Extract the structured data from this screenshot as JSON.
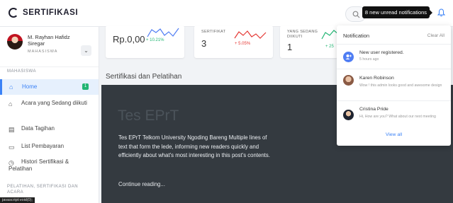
{
  "app": {
    "brand": "SERTIFIKASI"
  },
  "header": {
    "tooltip": "8 new unread notifications"
  },
  "profile": {
    "name": "M. Rayhan Hafidz Siregar",
    "role": "MAHASISWA"
  },
  "sidebar": {
    "heading1": "MAHASISWA",
    "items": [
      {
        "label": "Home",
        "icon": "home-icon",
        "badge": "1"
      },
      {
        "label": "Acara yang Sedang diikuti",
        "icon": "event-icon"
      },
      {
        "label": "Data Tagihan",
        "icon": "document-icon"
      },
      {
        "label": "List Pembayaran",
        "icon": "card-icon"
      },
      {
        "label": "Histori Sertifikasi & Pelatihan",
        "icon": "history-icon"
      }
    ],
    "heading2": "PELATIHAN, SERTIFIKASI DAN ACARA"
  },
  "status_url": "javascript:void(0);",
  "stats": [
    {
      "label": "",
      "value": "Rp.0,00",
      "delta": "+ 10.21%",
      "delta_color": "#22b573",
      "spark_color": "#4f7df3"
    },
    {
      "label": "SERTIFIKAT",
      "value": "3",
      "delta": "+ 5.05%",
      "delta_color": "#e53935",
      "spark_color": "#e53935"
    },
    {
      "label": "YANG SEDANG DIIKUTI",
      "value": "1",
      "delta": "+ 25",
      "delta_color": "#22b573",
      "spark_color": "#22b573"
    }
  ],
  "main": {
    "section_title": "Sertifikasi dan Pelatihan",
    "hero_title": "Tes EPrT",
    "hero_text": "Tes EPrT Telkom University Ngoding Bareng Multiple lines of text that form the lede, informing new readers quickly and efficiently about what's most interesting in this post's contents.",
    "hero_link": "Continue reading..."
  },
  "notifications": {
    "title": "Notification",
    "clear": "Clear All",
    "items": [
      {
        "title": "New user registered.",
        "sub": "5 hours ago"
      },
      {
        "title": "Karen Robinson",
        "sub": "Wow ! this admin looks good and awesome design"
      },
      {
        "title": "Cristina Pride",
        "sub": "Hi, How are you? What about our next meeting"
      }
    ],
    "view_all": "View all"
  }
}
